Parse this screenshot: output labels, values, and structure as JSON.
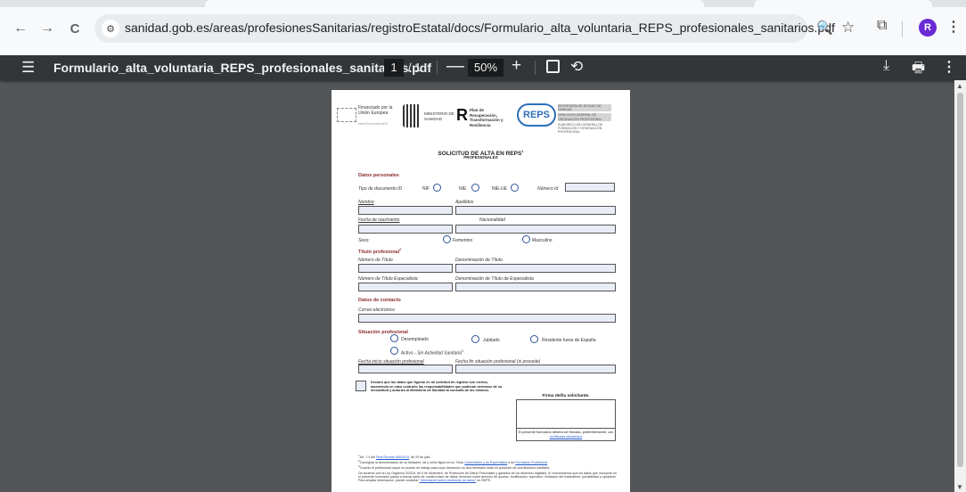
{
  "browser": {
    "url": "sanidad.gob.es/areas/profesionesSanitarias/registroEstatal/docs/Formulario_alta_voluntaria_REPS_profesionales_sanitarios.pdf",
    "avatar_letter": "R"
  },
  "icons": {
    "back": "←",
    "forward": "→",
    "reload": "C",
    "site_info": "⚙",
    "zoom": "🔍",
    "star": "☆",
    "extensions": "⧉",
    "kebab": "⋮",
    "menu": "☰",
    "minus": "—",
    "plus": "+",
    "rotate": "⟲",
    "download": "⤓",
    "print": "🖶",
    "up": "▲",
    "down": "▼"
  },
  "pdf_toolbar": {
    "title": "Formulario_alta_voluntaria_REPS_profesionales_sanitarios.pdf",
    "page_current": "1",
    "page_total": "/ 1",
    "zoom": "50%"
  },
  "doc": {
    "header": {
      "eu_text": "Financiado por la Unión Europea",
      "eu_sub": "NextGenerationEU",
      "ministry": "MINISTERIO DE SANIDAD",
      "plan": "Plan de Recuperación, Transformación y Resiliencia",
      "reps": "REPS",
      "sec1": "SECRETARÍA DE ESTADO DE SANIDAD",
      "sec2": "DIRECCIÓN GENERAL DE ORDENACIÓN PROFESIONAL",
      "sec3": "SUBDIRECCIÓN GENERAL DE FORMACIÓN Y ORDENACIÓN PROFESIONAL"
    },
    "title": "SOLICITUD DE ALTA EN REPS",
    "title_sup": "1",
    "subtitle": "PROFESIONALES",
    "datos_personales": "Datos personales",
    "tipo_doc": "Tipo de documento ID",
    "nif": "NIF",
    "nie": "NIE",
    "nie_ue": "NIE-UE",
    "numero_id": "Número Id",
    "nombre": "Nombre",
    "apellidos": "Apellidos",
    "fecha_nac": "Fecha de nacimiento",
    "nacionalidad": "Nacionalidad",
    "sexo": "Sexo:",
    "femenino": "Femenino",
    "masculino": "Masculino",
    "titulo_prof": "Título profesional",
    "titulo_sup": "2",
    "num_titulo": "Número de Título",
    "den_titulo": "Denominación de Título",
    "num_titulo_esp": "Número de Título Especialista",
    "den_titulo_esp": "Denominación de Título de Especialista",
    "datos_contacto": "Datos de contacto",
    "correo": "Correo electrónico",
    "situacion": "Situación profesional",
    "desempleado": "Desempleado",
    "jubilado": "Jubilado",
    "residente": "Residente fuera de España",
    "activo": "Activo",
    "activo_sub": " - Sin Actividad Sanitaria",
    "activo_sup": "3",
    "fecha_inicio": "Fecha inicio situación profesional",
    "fecha_fin": "Fecha fin situación profesional (si procede)",
    "declaracion": "Declaro que los datos que figuran en mi solicitud de registro son ciertos, asumiendo en caso contrario las responsabilidades que pudieran derivarse de su inexactitud y autorizo al Ministerio de Sanidad la consulta de los mismos.",
    "firma": "Firma del/la solicitante.",
    "firma_nota": "El presente formulario deberá ser firmado, preferiblemente, con",
    "firma_link": "certificado electrónico",
    "fn1_pre": "Art. 7.4 del",
    "fn1_link": "Real Decreto 640/2014",
    "fn1_post": ", de 25 de julio.",
    "fn2_pre": "Consignar la denominación de su titulación, tal y como figura en su Título",
    "fn2_link1": "Universitario y de Especialista",
    "fn2_mid": " o de ",
    "fn2_link2": "Formación Profesional",
    "fn3": "Cuando el profesional ocupe un puesto de trabajo para cuyo desarrollo no sea necesario estar en posesión de una titulación sanitaria.",
    "fn4": "De acuerdo con la Ley Orgánica 3/2018, de 5 de diciembre, de Protección de Datos Personales y garantía de los derechos digitales, le comunicamos que los datos que incorpore en el presente formulario pasan a formar parte de nuestra base de datos, teniendo usted derecho de acceso, rectificación, supresión, limitación del tratamiento, portabilidad y oposición. Para ampliar información, puede consultar",
    "fn4_link": "\"Información sobre protección de datos\"",
    "fn4_post": " en REPS."
  }
}
